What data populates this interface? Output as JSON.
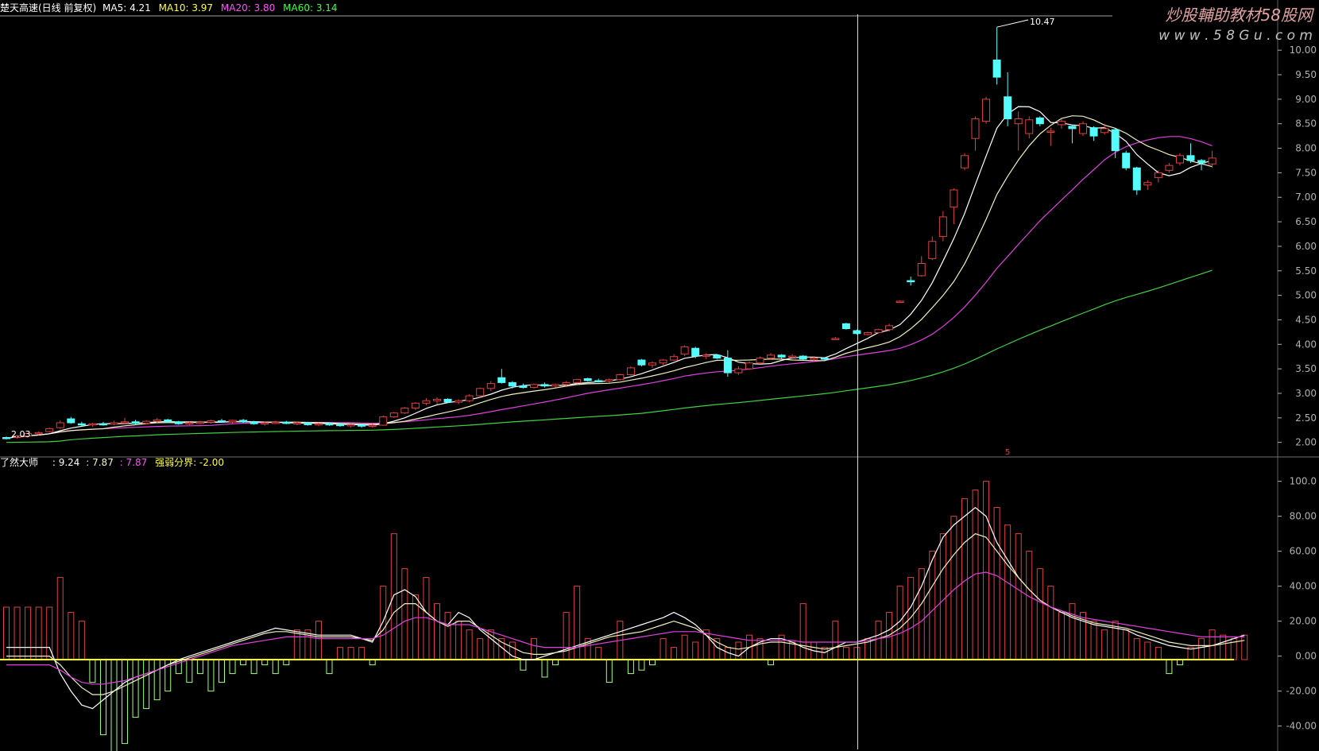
{
  "header": {
    "stock_title": "楚天高速(日线 前复权)",
    "ma5": "MA5: 4.21",
    "ma10": "MA10: 3.97",
    "ma20": "MA20: 3.80",
    "ma60": "MA60: 3.14"
  },
  "watermark": {
    "cn_text": "炒股輔助教材58股网",
    "url_text": "w w w . 5 8 G u . c o m"
  },
  "colors": {
    "background": "#000000",
    "up": "#e04040",
    "down": "#54fcfc",
    "ma5": "#ffffff",
    "ma10": "#f0f0c0",
    "ma20": "#e040e0",
    "ma60": "#40d040",
    "axis": "#b0b0b0",
    "header_white": "#ffffff",
    "header_yellow": "#ffff40",
    "header_magenta": "#ff50ff",
    "header_green": "#40ff40",
    "baseline": "#ffff00",
    "hist_pos": "#e04040",
    "hist_neg": "#a0ff80",
    "watermark_cn": "#e0a0a0",
    "watermark_num": "#ffff40",
    "watermark_url": "#c0c0c0"
  },
  "annotations": {
    "peak_label": "10.47",
    "low_label": "2.03",
    "marker_label": "5"
  },
  "indicator": {
    "name": "了然大师",
    "v1": ": 9.24",
    "v2": ": 7.87",
    "v3": ": 7.87",
    "boundary_label": "强弱分界: -2.00"
  },
  "chart_data": [
    {
      "type": "candlestick",
      "title": "楚天高速(日线 前复权)",
      "ylim": [
        1.8,
        10.7
      ],
      "y_ticks": [
        "10.00",
        "9.50",
        "9.00",
        "8.50",
        "8.00",
        "7.50",
        "7.00",
        "6.50",
        "6.00",
        "5.50",
        "5.00",
        "4.50",
        "4.00",
        "3.50",
        "3.00",
        "2.50",
        "2.00"
      ],
      "candles": [
        [
          2.1,
          2.12,
          2.06,
          2.09
        ],
        [
          2.1,
          2.15,
          2.08,
          2.13
        ],
        [
          2.13,
          2.2,
          2.1,
          2.18
        ],
        [
          2.18,
          2.22,
          2.15,
          2.2
        ],
        [
          2.22,
          2.3,
          2.2,
          2.28
        ],
        [
          2.3,
          2.45,
          2.28,
          2.4
        ],
        [
          2.48,
          2.52,
          2.38,
          2.4
        ],
        [
          2.38,
          2.42,
          2.33,
          2.36
        ],
        [
          2.36,
          2.4,
          2.32,
          2.38
        ],
        [
          2.38,
          2.42,
          2.34,
          2.37
        ],
        [
          2.37,
          2.44,
          2.35,
          2.4
        ],
        [
          2.4,
          2.5,
          2.38,
          2.42
        ],
        [
          2.42,
          2.46,
          2.36,
          2.39
        ],
        [
          2.39,
          2.45,
          2.37,
          2.43
        ],
        [
          2.43,
          2.5,
          2.4,
          2.46
        ],
        [
          2.46,
          2.48,
          2.4,
          2.42
        ],
        [
          2.42,
          2.44,
          2.36,
          2.38
        ],
        [
          2.38,
          2.42,
          2.35,
          2.4
        ],
        [
          2.4,
          2.44,
          2.37,
          2.41
        ],
        [
          2.41,
          2.46,
          2.38,
          2.44
        ],
        [
          2.44,
          2.48,
          2.4,
          2.42
        ],
        [
          2.42,
          2.46,
          2.38,
          2.45
        ],
        [
          2.45,
          2.48,
          2.4,
          2.42
        ],
        [
          2.42,
          2.44,
          2.36,
          2.38
        ],
        [
          2.38,
          2.42,
          2.34,
          2.4
        ],
        [
          2.4,
          2.44,
          2.38,
          2.41
        ],
        [
          2.41,
          2.44,
          2.37,
          2.39
        ],
        [
          2.39,
          2.42,
          2.35,
          2.4
        ],
        [
          2.4,
          2.42,
          2.34,
          2.36
        ],
        [
          2.36,
          2.4,
          2.33,
          2.38
        ],
        [
          2.38,
          2.41,
          2.34,
          2.37
        ],
        [
          2.37,
          2.4,
          2.32,
          2.34
        ],
        [
          2.34,
          2.38,
          2.3,
          2.36
        ],
        [
          2.36,
          2.38,
          2.3,
          2.33
        ],
        [
          2.33,
          2.38,
          2.3,
          2.35
        ],
        [
          2.35,
          2.55,
          2.34,
          2.52
        ],
        [
          2.52,
          2.62,
          2.5,
          2.6
        ],
        [
          2.6,
          2.72,
          2.58,
          2.7
        ],
        [
          2.7,
          2.82,
          2.66,
          2.8
        ],
        [
          2.8,
          2.9,
          2.76,
          2.85
        ],
        [
          2.85,
          2.92,
          2.78,
          2.88
        ],
        [
          2.88,
          2.9,
          2.8,
          2.82
        ],
        [
          2.82,
          2.88,
          2.78,
          2.85
        ],
        [
          2.85,
          2.98,
          2.82,
          2.95
        ],
        [
          2.95,
          3.12,
          2.92,
          3.1
        ],
        [
          3.1,
          3.25,
          3.05,
          3.2
        ],
        [
          3.32,
          3.5,
          3.2,
          3.22
        ],
        [
          3.22,
          3.25,
          3.1,
          3.15
        ],
        [
          3.15,
          3.2,
          3.1,
          3.12
        ],
        [
          3.12,
          3.2,
          3.1,
          3.18
        ],
        [
          3.18,
          3.22,
          3.12,
          3.15
        ],
        [
          3.15,
          3.2,
          3.12,
          3.18
        ],
        [
          3.18,
          3.25,
          3.15,
          3.22
        ],
        [
          3.22,
          3.3,
          3.2,
          3.28
        ],
        [
          3.3,
          3.32,
          3.24,
          3.26
        ],
        [
          3.26,
          3.3,
          3.22,
          3.25
        ],
        [
          3.25,
          3.3,
          3.22,
          3.28
        ],
        [
          3.28,
          3.4,
          3.26,
          3.38
        ],
        [
          3.38,
          3.55,
          3.36,
          3.52
        ],
        [
          3.68,
          3.7,
          3.55,
          3.58
        ],
        [
          3.58,
          3.65,
          3.52,
          3.62
        ],
        [
          3.62,
          3.7,
          3.58,
          3.68
        ],
        [
          3.68,
          3.8,
          3.66,
          3.75
        ],
        [
          3.8,
          3.98,
          3.76,
          3.95
        ],
        [
          3.92,
          3.95,
          3.72,
          3.76
        ],
        [
          3.76,
          3.82,
          3.7,
          3.78
        ],
        [
          3.78,
          3.8,
          3.7,
          3.72
        ],
        [
          3.72,
          3.88,
          3.34,
          3.42
        ],
        [
          3.42,
          3.55,
          3.38,
          3.5
        ],
        [
          3.5,
          3.65,
          3.48,
          3.62
        ],
        [
          3.62,
          3.75,
          3.6,
          3.72
        ],
        [
          3.72,
          3.82,
          3.68,
          3.78
        ],
        [
          3.78,
          3.8,
          3.7,
          3.74
        ],
        [
          3.74,
          3.8,
          3.7,
          3.76
        ],
        [
          3.76,
          3.78,
          3.68,
          3.7
        ],
        [
          3.7,
          3.76,
          3.66,
          3.72
        ],
        [
          3.72,
          3.74,
          3.68,
          3.71
        ],
        [
          4.12,
          4.15,
          4.1,
          4.12
        ],
        [
          4.42,
          4.44,
          4.3,
          4.32
        ],
        [
          4.28,
          4.3,
          4.2,
          4.22
        ],
        [
          4.2,
          4.26,
          4.18,
          4.24
        ],
        [
          4.24,
          4.32,
          4.22,
          4.3
        ],
        [
          4.3,
          4.42,
          4.26,
          4.38
        ],
        [
          4.88,
          4.9,
          4.86,
          4.88
        ],
        [
          5.3,
          5.38,
          5.2,
          5.28
        ],
        [
          5.4,
          5.8,
          5.38,
          5.65
        ],
        [
          5.75,
          6.2,
          5.72,
          6.1
        ],
        [
          6.2,
          6.72,
          6.1,
          6.6
        ],
        [
          6.8,
          7.18,
          6.45,
          7.15
        ],
        [
          7.6,
          7.9,
          7.55,
          7.85
        ],
        [
          8.2,
          8.65,
          7.95,
          8.6
        ],
        [
          8.55,
          9.05,
          8.5,
          9.0
        ],
        [
          9.8,
          10.47,
          9.3,
          9.45
        ],
        [
          9.05,
          9.55,
          8.45,
          8.6
        ],
        [
          8.5,
          8.75,
          7.95,
          8.6
        ],
        [
          8.3,
          8.65,
          8.2,
          8.58
        ],
        [
          8.62,
          8.65,
          8.45,
          8.5
        ],
        [
          8.35,
          8.42,
          8.05,
          8.35
        ],
        [
          8.48,
          8.6,
          8.4,
          8.55
        ],
        [
          8.45,
          8.48,
          8.1,
          8.4
        ],
        [
          8.3,
          8.55,
          8.25,
          8.5
        ],
        [
          8.42,
          8.45,
          8.15,
          8.25
        ],
        [
          8.32,
          8.5,
          8.28,
          8.4
        ],
        [
          8.38,
          8.4,
          7.8,
          7.95
        ],
        [
          7.9,
          7.95,
          7.55,
          7.6
        ],
        [
          7.6,
          7.62,
          7.05,
          7.15
        ],
        [
          7.25,
          7.35,
          7.15,
          7.3
        ],
        [
          7.4,
          7.55,
          7.3,
          7.5
        ],
        [
          7.55,
          7.7,
          7.5,
          7.65
        ],
        [
          7.7,
          7.9,
          7.65,
          7.85
        ],
        [
          7.85,
          8.1,
          7.7,
          7.75
        ],
        [
          7.75,
          7.78,
          7.55,
          7.7
        ],
        [
          7.68,
          7.95,
          7.6,
          7.8
        ]
      ]
    },
    {
      "type": "bar+line",
      "title": "了然大师",
      "ylim": [
        -52,
        108
      ],
      "y_ticks": [
        "100.0",
        "80.00",
        "60.00",
        "40.00",
        "20.00",
        "0.00",
        "-20.00",
        "-40.00"
      ],
      "threshold": -2,
      "hist": [
        28,
        28,
        28,
        28,
        28,
        45,
        25,
        20,
        -15,
        -45,
        -55,
        -50,
        -35,
        -30,
        -25,
        -20,
        -10,
        -15,
        -10,
        -20,
        -15,
        -10,
        -5,
        -10,
        -5,
        -10,
        -5,
        15,
        15,
        20,
        -10,
        5,
        5,
        5,
        -5,
        40,
        70,
        50,
        35,
        45,
        30,
        25,
        20,
        15,
        10,
        15,
        10,
        8,
        -8,
        10,
        -12,
        -5,
        25,
        40,
        10,
        5,
        -15,
        20,
        -10,
        -8,
        -5,
        10,
        5,
        12,
        8,
        15,
        10,
        5,
        8,
        12,
        10,
        -5,
        12,
        8,
        30,
        8,
        5,
        20,
        5,
        5,
        10,
        20,
        25,
        40,
        45,
        50,
        60,
        70,
        80,
        90,
        95,
        100,
        85,
        75,
        70,
        60,
        50,
        40,
        25,
        30,
        25,
        20,
        15,
        20,
        15,
        10,
        8,
        5,
        -10,
        -5,
        5,
        10,
        15,
        12,
        10,
        12
      ],
      "lines": [
        [
          5,
          5,
          5,
          5,
          5,
          -10,
          -20,
          -28,
          -30,
          -25,
          -20,
          -15,
          -12,
          -10,
          -8,
          -5,
          -2,
          0,
          2,
          4,
          6,
          8,
          10,
          12,
          14,
          16,
          15,
          14,
          13,
          12,
          12,
          12,
          12,
          10,
          8,
          20,
          35,
          38,
          34,
          25,
          20,
          18,
          25,
          22,
          15,
          10,
          5,
          0,
          -2,
          -2,
          0,
          2,
          4,
          6,
          8,
          10,
          12,
          14,
          16,
          18,
          20,
          22,
          25,
          22,
          18,
          12,
          5,
          2,
          0,
          5,
          8,
          10,
          10,
          8,
          5,
          3,
          2,
          5,
          8,
          8,
          10,
          12,
          15,
          20,
          28,
          40,
          55,
          68,
          75,
          80,
          85,
          80,
          65,
          55,
          45,
          38,
          32,
          28,
          25,
          22,
          20,
          18,
          17,
          16,
          15,
          12,
          10,
          8,
          6,
          5,
          4,
          5,
          6,
          8,
          10,
          12
        ],
        [
          0,
          0,
          0,
          0,
          0,
          -5,
          -12,
          -18,
          -22,
          -22,
          -20,
          -17,
          -14,
          -11,
          -8,
          -5,
          -3,
          -1,
          1,
          3,
          5,
          7,
          9,
          11,
          13,
          14,
          14,
          13,
          12,
          11,
          11,
          11,
          11,
          10,
          9,
          15,
          25,
          30,
          30,
          25,
          20,
          17,
          20,
          20,
          16,
          12,
          8,
          5,
          2,
          1,
          1,
          2,
          3,
          5,
          7,
          9,
          11,
          12,
          13,
          14,
          16,
          18,
          20,
          18,
          16,
          12,
          8,
          5,
          4,
          5,
          7,
          8,
          8,
          7,
          6,
          5,
          4,
          5,
          6,
          7,
          8,
          10,
          12,
          16,
          22,
          30,
          40,
          50,
          58,
          65,
          70,
          68,
          60,
          52,
          45,
          38,
          32,
          28,
          26,
          23,
          21,
          19,
          18,
          17,
          16,
          14,
          12,
          10,
          8,
          7,
          6,
          6,
          6,
          7,
          8,
          9
        ],
        [
          -5,
          -5,
          -5,
          -5,
          -5,
          -8,
          -12,
          -15,
          -16,
          -16,
          -15,
          -14,
          -12,
          -10,
          -8,
          -6,
          -4,
          -2,
          0,
          2,
          4,
          6,
          7,
          8,
          9,
          10,
          11,
          11,
          11,
          10,
          10,
          10,
          10,
          10,
          10,
          12,
          16,
          20,
          22,
          22,
          20,
          18,
          18,
          18,
          16,
          14,
          12,
          10,
          8,
          6,
          5,
          5,
          5,
          5,
          6,
          7,
          8,
          9,
          10,
          11,
          12,
          13,
          14,
          14,
          14,
          13,
          12,
          11,
          10,
          9,
          9,
          9,
          9,
          9,
          8,
          8,
          8,
          8,
          8,
          8,
          9,
          10,
          11,
          13,
          16,
          20,
          26,
          32,
          38,
          43,
          47,
          48,
          46,
          42,
          38,
          34,
          31,
          28,
          26,
          24,
          22,
          21,
          20,
          19,
          18,
          17,
          16,
          15,
          14,
          13,
          12,
          11,
          11,
          11,
          11,
          11
        ]
      ]
    }
  ]
}
